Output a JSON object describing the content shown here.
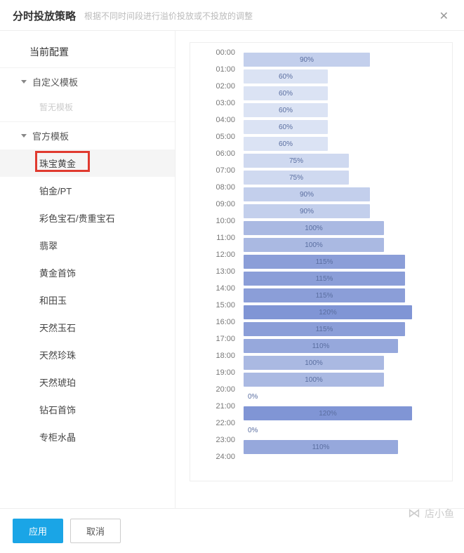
{
  "header": {
    "title": "分时投放策略",
    "subtitle": "根据不同时间段进行溢价投放或不投放的调整",
    "close": "✕"
  },
  "sidebar": {
    "current_config": "当前配置",
    "groups": [
      {
        "label": "自定义模板",
        "empty": "暂无模板",
        "items": []
      },
      {
        "label": "官方模板",
        "items": [
          {
            "label": "珠宝黄金",
            "selected": true
          },
          {
            "label": "铂金/PT"
          },
          {
            "label": "彩色宝石/贵重宝石"
          },
          {
            "label": "翡翠"
          },
          {
            "label": "黄金首饰"
          },
          {
            "label": "和田玉"
          },
          {
            "label": "天然玉石"
          },
          {
            "label": "天然珍珠"
          },
          {
            "label": "天然琥珀"
          },
          {
            "label": "钻石首饰"
          },
          {
            "label": "专柜水晶"
          }
        ]
      }
    ]
  },
  "chart_data": {
    "type": "bar",
    "orientation": "horizontal",
    "xlabel": "",
    "ylabel": "",
    "xlim": [
      0,
      240
    ],
    "categories": [
      "00:00",
      "01:00",
      "02:00",
      "03:00",
      "04:00",
      "05:00",
      "06:00",
      "07:00",
      "08:00",
      "09:00",
      "10:00",
      "11:00",
      "12:00",
      "13:00",
      "14:00",
      "15:00",
      "16:00",
      "17:00",
      "18:00",
      "19:00",
      "20:00",
      "21:00",
      "22:00",
      "23:00",
      "24:00"
    ],
    "values": [
      90,
      60,
      60,
      60,
      60,
      60,
      75,
      75,
      90,
      90,
      100,
      100,
      115,
      115,
      115,
      120,
      115,
      110,
      100,
      100,
      0,
      120,
      0,
      110,
      null
    ],
    "labels": [
      "90%",
      "60%",
      "60%",
      "60%",
      "60%",
      "60%",
      "75%",
      "75%",
      "90%",
      "90%",
      "100%",
      "100%",
      "115%",
      "115%",
      "115%",
      "120%",
      "115%",
      "110%",
      "100%",
      "100%",
      "0%",
      "120%",
      "0%",
      "110%",
      ""
    ],
    "max_width_pct": 120
  },
  "colors": {
    "palette": {
      "0": "#ffffff",
      "60": "#dbe3f4",
      "75": "#cfd9f0",
      "90": "#c3cfec",
      "100": "#aab9e2",
      "110": "#96a8dc",
      "115": "#8b9ed8",
      "120": "#8095d5"
    }
  },
  "footer": {
    "apply": "应用",
    "cancel": "取消"
  },
  "watermark": {
    "icon": "⋈",
    "text": "店小鱼"
  }
}
